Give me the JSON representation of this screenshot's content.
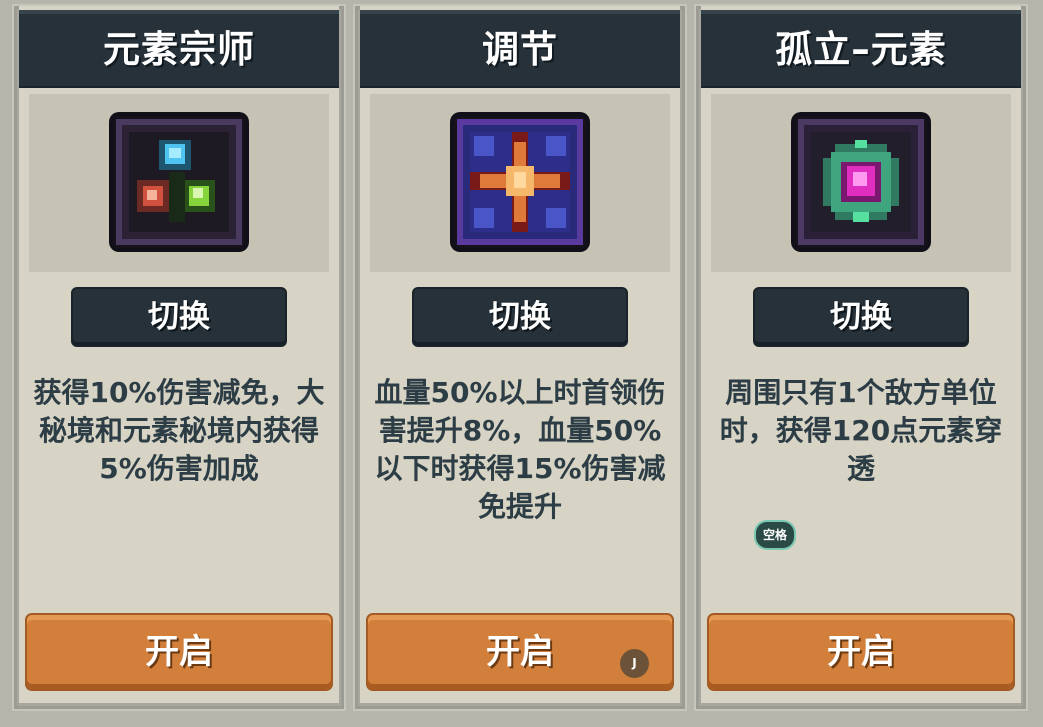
{
  "cards": [
    {
      "title": "元素宗师",
      "icon": "element-master-icon",
      "switch_label": "切换",
      "description": "获得10%伤害减免，大秘境和元素秘境内获得5%伤害加成",
      "open_label": "开启"
    },
    {
      "title": "调节",
      "icon": "adjust-star-icon",
      "switch_label": "切换",
      "description": "血量50%以上时首领伤害提升8%，血量50%以下时获得15%伤害减免提升",
      "open_label": "开启"
    },
    {
      "title": "孤立–元素",
      "icon": "isolated-element-gem-icon",
      "switch_label": "切换",
      "description": "周围只有1个敌方单位时，获得120点元素穿透",
      "open_label": "开启"
    }
  ],
  "overlay": {
    "space_badge": "空格",
    "j_badge": "J"
  },
  "colors": {
    "title_bg": "#263139",
    "card_bg": "#d7d3c5",
    "open_button": "#d17f3b",
    "description_text": "#2d3d45"
  }
}
